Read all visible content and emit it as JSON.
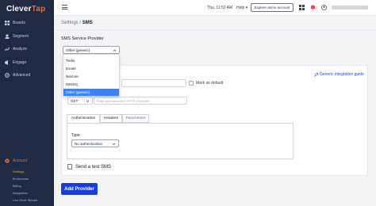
{
  "app": {
    "logo_main": "Clever",
    "logo_accent": "Tap"
  },
  "sidebar": {
    "items": [
      {
        "label": "Boards",
        "icon": "boards-icon"
      },
      {
        "label": "Segment",
        "icon": "segment-icon"
      },
      {
        "label": "Analyze",
        "icon": "analyze-icon"
      },
      {
        "label": "Engage",
        "icon": "engage-icon"
      },
      {
        "label": "Advanced",
        "icon": "advanced-icon"
      }
    ],
    "account": {
      "label": "Account",
      "icon": "account-icon"
    },
    "sub_items": [
      "Settings",
      "Bookmarks",
      "Billing",
      "Integration",
      "Live Error Stream"
    ]
  },
  "topbar": {
    "datetime": "Thu, 11:52 AM",
    "help_label": "Help",
    "demo_button": "Explore demo account"
  },
  "breadcrumb": {
    "parent": "Settings / ",
    "current": "SMS"
  },
  "provider": {
    "section_label": "SMS Service Provider",
    "selected": "Other (generic)",
    "options": [
      "Twilio",
      "Exotel",
      "Netcore",
      "MSG91",
      "Other (generic)"
    ],
    "selected_index": 4
  },
  "guide_link": "Generic integration guide",
  "mark_default_label": "Mark as default",
  "request": {
    "method": "GET",
    "url_placeholder": "Enter your provider's HTTP end point"
  },
  "tabs": [
    "Authentication",
    "Headers",
    "Parameters"
  ],
  "auth": {
    "type_label": "Type",
    "type_value": "No authentication"
  },
  "send_test_label": "Send a test SMS",
  "add_provider_button": "Add Provider",
  "colors": {
    "sidebar": "#1f2a44",
    "brand": "#f56a2a",
    "primary_button": "#1a3cd9",
    "selected_option": "#3b82f6",
    "link": "#1d4ed8"
  }
}
